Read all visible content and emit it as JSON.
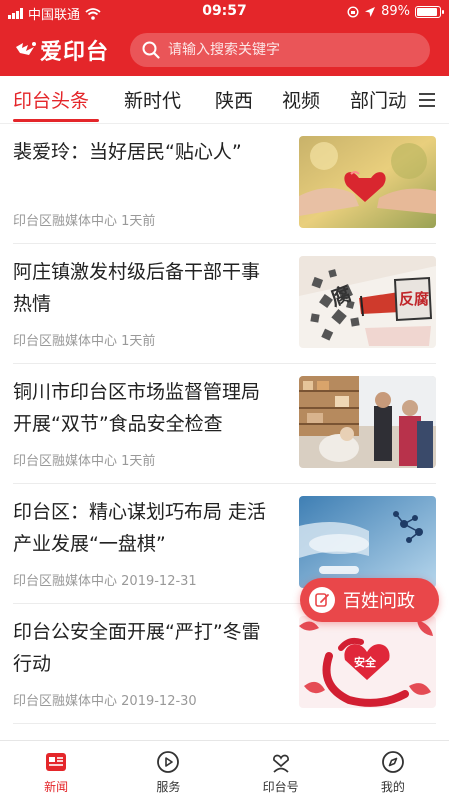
{
  "status_bar": {
    "carrier": "中国联通",
    "time": "09:57",
    "battery_percent": "89%",
    "battery_level": 0.89
  },
  "app": {
    "logo_text": "爱印台",
    "search_placeholder": "请输入搜索关键字"
  },
  "tabs": [
    {
      "label": "印台头条",
      "active": true
    },
    {
      "label": "新时代",
      "active": false
    },
    {
      "label": "陕西",
      "active": false
    },
    {
      "label": "视频",
      "active": false
    },
    {
      "label": "部门动",
      "active": false
    }
  ],
  "news": [
    {
      "title": "裴爱玲：当好居民“贴心人”",
      "source": "印台区融媒体中心",
      "time": "1天前",
      "image": "heart-in-hands-photo"
    },
    {
      "title": "阿庄镇激发村级后备干部干事热情",
      "source": "印台区融媒体中心",
      "time": "1天前",
      "image": "anti-corruption-illustration",
      "image_text": "反腐"
    },
    {
      "title": "铜川市印台区市场监督管理局开展“双节”食品安全检查",
      "source": "印台区融媒体中心",
      "time": "1天前",
      "image": "inspection-photo"
    },
    {
      "title": "印台区：精心谋划巧布局 走活产业发展“一盘棋”",
      "source": "印台区融媒体中心",
      "time": "2019-12-31",
      "image": "industry-photo"
    },
    {
      "title": "印台公安全面开展“严打”冬雷行动",
      "source": "印台区融媒体中心",
      "time": "2019-12-30",
      "image": "safety-illustration",
      "image_text": "安全"
    }
  ],
  "float_button": {
    "label": "百姓问政"
  },
  "bottom_nav": [
    {
      "label": "新闻",
      "icon": "news-icon",
      "active": true
    },
    {
      "label": "服务",
      "icon": "play-circle-icon",
      "active": false
    },
    {
      "label": "印台号",
      "icon": "heart-person-icon",
      "active": false
    },
    {
      "label": "我的",
      "icon": "compass-icon",
      "active": false
    }
  ],
  "colors": {
    "brand_red": "#e4262a",
    "meta_gray": "#999999"
  }
}
